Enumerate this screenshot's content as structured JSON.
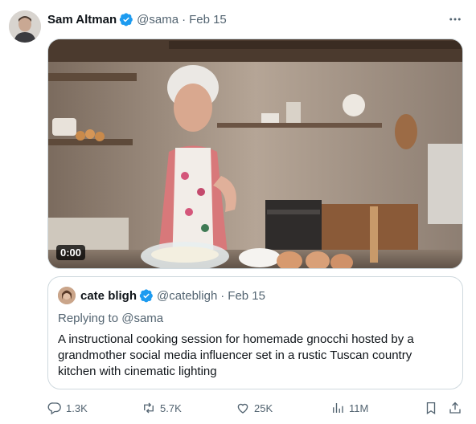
{
  "tweet": {
    "author_name": "Sam Altman",
    "handle": "@sama",
    "separator": "·",
    "date": "Feb 15",
    "media_timestamp": "0:00"
  },
  "quoted": {
    "author_name": "cate bligh",
    "handle": "@catebligh",
    "separator": "·",
    "date": "Feb 15",
    "replying_to": "Replying to @sama",
    "text": "A instructional cooking session for homemade gnocchi hosted by a grandmother social media influencer set in a rustic Tuscan country kitchen with cinematic lighting"
  },
  "actions": {
    "replies": "1.3K",
    "reposts": "5.7K",
    "likes": "25K",
    "views": "11M"
  },
  "icons": [
    "avatar",
    "verified-badge-icon",
    "more-icon",
    "reply-icon",
    "repost-icon",
    "like-icon",
    "views-icon",
    "bookmark-icon",
    "share-icon"
  ],
  "colors": {
    "verified": "#1d9bf0",
    "muted": "#536471",
    "border": "#cfd9de"
  }
}
